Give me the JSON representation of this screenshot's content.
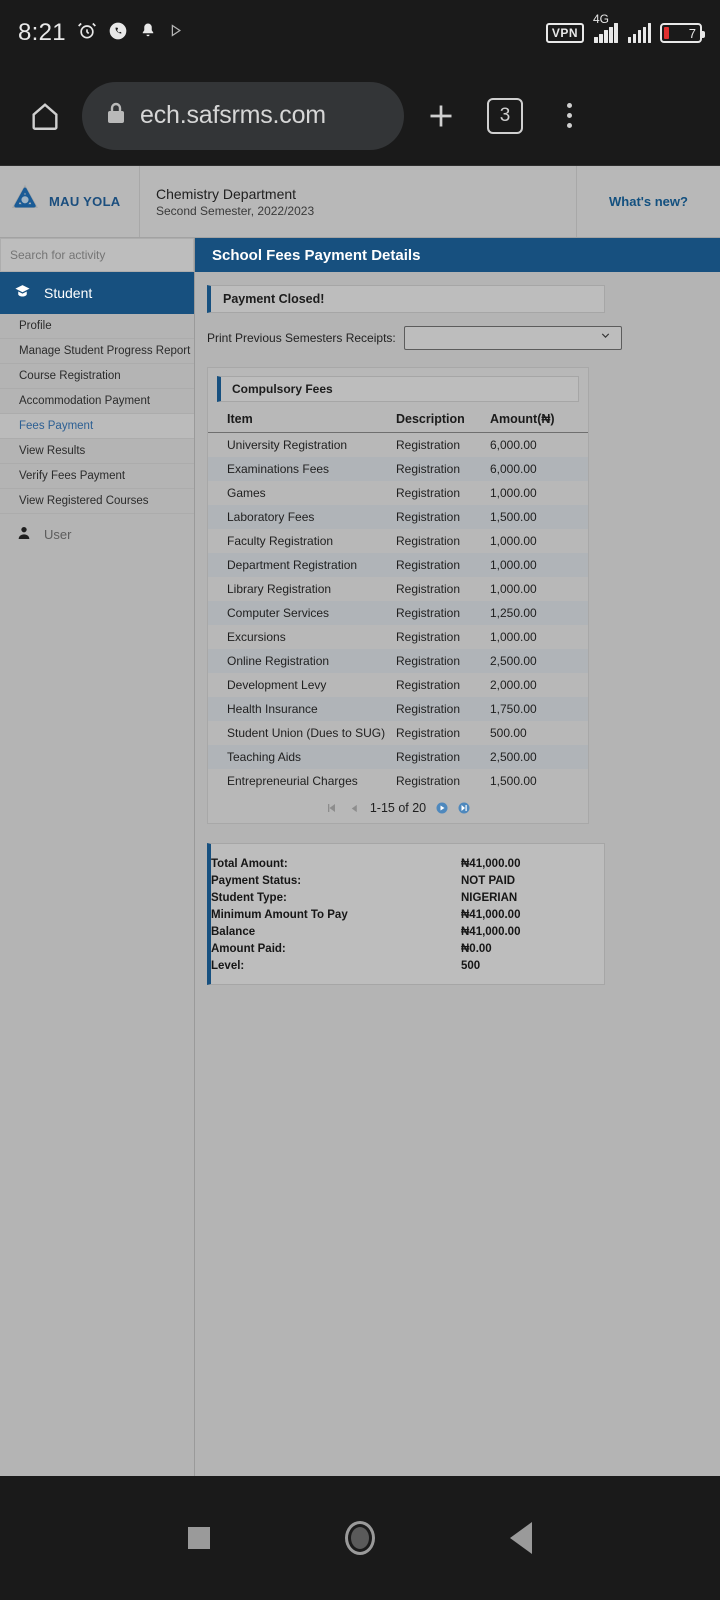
{
  "status_bar": {
    "time": "8:21",
    "icons_left": [
      "alarm-icon",
      "whatsapp-icon",
      "notification-bell-icon",
      "play-icon"
    ],
    "vpn_label": "VPN",
    "network_type": "4G",
    "battery_percent": "7"
  },
  "browser": {
    "url": "ech.safsrms.com",
    "tab_count": "3",
    "home_icon": "home-icon",
    "lock_icon": "lock-icon",
    "new_tab_icon": "plus-icon",
    "menu_icon": "kebab-menu-icon"
  },
  "app_header": {
    "brand_name": "MAU YOLA",
    "department": "Chemistry Department",
    "semester": "Second Semester, 2022/2023",
    "whats_new": "What's new?"
  },
  "sidebar": {
    "search_placeholder": "Search for activity",
    "section_label": "Student",
    "section_icon": "graduation-cap-icon",
    "items": [
      {
        "label": "Profile"
      },
      {
        "label": "Manage Student Progress Report"
      },
      {
        "label": "Course Registration"
      },
      {
        "label": "Accommodation Payment"
      },
      {
        "label": "Fees Payment"
      },
      {
        "label": "View Results"
      },
      {
        "label": "Verify Fees Payment"
      },
      {
        "label": "View Registered Courses"
      }
    ],
    "active_item": "Fees Payment",
    "user_label": "User",
    "user_icon": "person-icon"
  },
  "main": {
    "page_title": "School Fees Payment Details",
    "alert_text": "Payment Closed!",
    "receipts_label": "Print Previous Semesters Receipts:",
    "receipts_selected": "",
    "fees_panel_title": "Compulsory Fees",
    "table": {
      "columns": [
        "Item",
        "Description",
        "Amount(₦)"
      ],
      "rows": [
        {
          "item": "University Registration",
          "description": "Registration",
          "amount": "6,000.00"
        },
        {
          "item": "Examinations Fees",
          "description": "Registration",
          "amount": "6,000.00"
        },
        {
          "item": "Games",
          "description": "Registration",
          "amount": "1,000.00"
        },
        {
          "item": "Laboratory Fees",
          "description": "Registration",
          "amount": "1,500.00"
        },
        {
          "item": "Faculty Registration",
          "description": "Registration",
          "amount": "1,000.00"
        },
        {
          "item": "Department Registration",
          "description": "Registration",
          "amount": "1,000.00"
        },
        {
          "item": "Library Registration",
          "description": "Registration",
          "amount": "1,000.00"
        },
        {
          "item": "Computer Services",
          "description": "Registration",
          "amount": "1,250.00"
        },
        {
          "item": "Excursions",
          "description": "Registration",
          "amount": "1,000.00"
        },
        {
          "item": "Online Registration",
          "description": "Registration",
          "amount": "2,500.00"
        },
        {
          "item": "Development Levy",
          "description": "Registration",
          "amount": "2,000.00"
        },
        {
          "item": "Health Insurance",
          "description": "Registration",
          "amount": "1,750.00"
        },
        {
          "item": "Student Union (Dues to SUG)",
          "description": "Registration",
          "amount": "500.00"
        },
        {
          "item": "Teaching Aids",
          "description": "Registration",
          "amount": "2,500.00"
        },
        {
          "item": "Entrepreneurial Charges",
          "description": "Registration",
          "amount": "1,500.00"
        }
      ],
      "pagination": {
        "range_text": "1-15 of 20",
        "first_icon": "first-page-icon",
        "prev_icon": "previous-page-icon",
        "next_icon": "next-page-icon",
        "last_icon": "last-page-icon"
      }
    },
    "summary": [
      {
        "label": "Total Amount:",
        "value": "₦41,000.00"
      },
      {
        "label": "Payment Status:",
        "value": "NOT PAID"
      },
      {
        "label": "Student Type:",
        "value": "NIGERIAN"
      },
      {
        "label": "Minimum Amount To Pay",
        "value": "₦41,000.00"
      },
      {
        "label": "Balance",
        "value": "₦41,000.00"
      },
      {
        "label": "Amount Paid:",
        "value": "₦0.00"
      },
      {
        "label": "Level:",
        "value": "500"
      }
    ]
  },
  "nav_bar": {
    "recents_icon": "square-recents-icon",
    "home_icon": "circle-home-icon",
    "back_icon": "triangle-back-icon"
  },
  "colors": {
    "primary_blue": "#17507f",
    "page_bg": "#b4b4b4",
    "chrome_dark": "#1a1a1a",
    "battery_red": "#e03030"
  }
}
